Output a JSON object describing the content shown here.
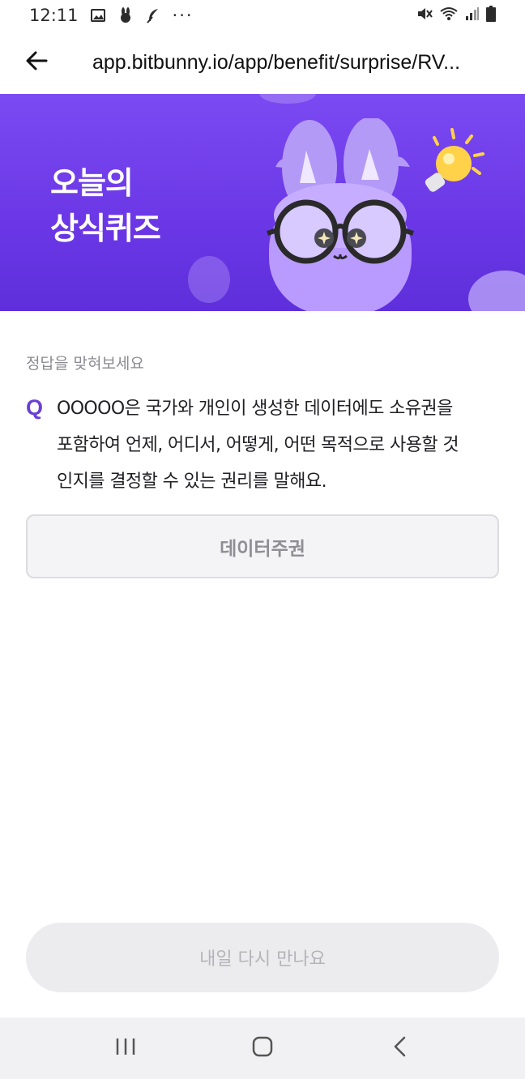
{
  "status_bar": {
    "time": "12:11",
    "dots": "···",
    "left_icons": [
      "image-icon",
      "bunny-icon",
      "feather-icon"
    ],
    "right_icons": [
      "mute-icon",
      "wifi-icon",
      "signal-icon",
      "battery-icon"
    ]
  },
  "browser": {
    "back_icon": "arrow-left-icon",
    "url": "app.bitbunny.io/app/benefit/surprise/RV..."
  },
  "banner": {
    "title_line1": "오늘의",
    "title_line2": "상식퀴즈",
    "colors": {
      "background": "#7b4af2",
      "character": "#b99bff",
      "bulb": "#ffd24a"
    }
  },
  "quiz": {
    "label": "정답을 맞혀보세요",
    "q_mark": "Q",
    "question_line1": "OOOOO은 국가와 개인이 생성한 데이터에도 소유권을",
    "question_line2": "포함하여 언제, 어디서, 어떻게, 어떤 목적으로 사용할 것",
    "question_line3": "인지를 결정할 수 있는 권리를 말해요.",
    "answer": "데이터주권"
  },
  "footer": {
    "button_label": "내일 다시 만나요"
  },
  "nav": {
    "items": [
      "recent-apps-icon",
      "home-icon",
      "back-icon"
    ]
  },
  "colors": {
    "accent": "#6a3fd6",
    "muted_text": "#8a8a90"
  }
}
